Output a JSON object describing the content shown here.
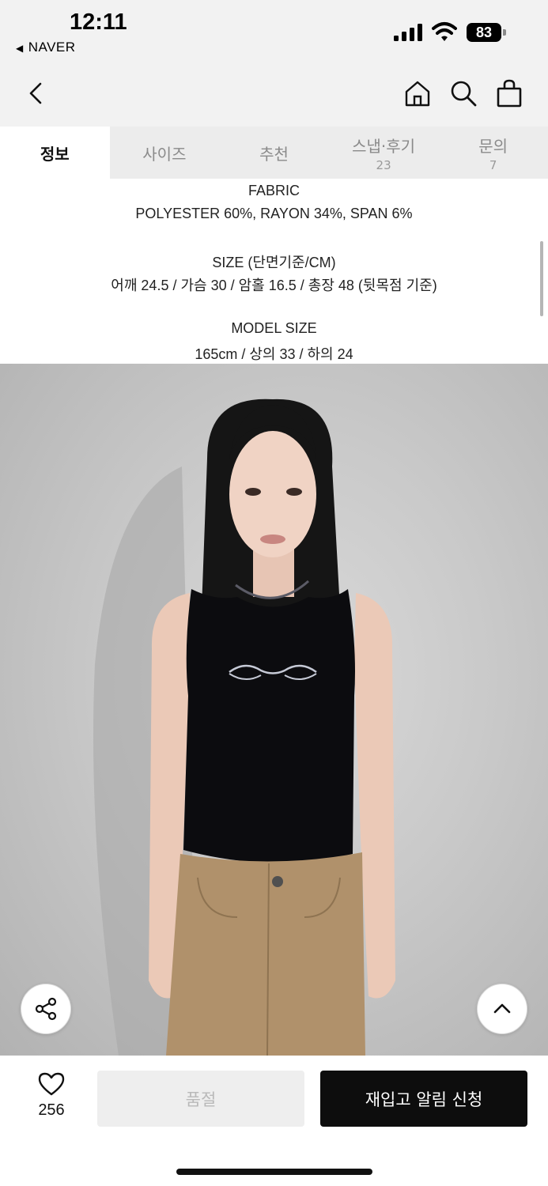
{
  "status_bar": {
    "time": "12:11",
    "back_app": "NAVER",
    "battery": "83"
  },
  "nav": {
    "icons": [
      "chevron-left-icon",
      "home-icon",
      "search-icon",
      "shopping-bag-icon"
    ]
  },
  "tabs": [
    {
      "label": "정보",
      "active": true
    },
    {
      "label": "사이즈"
    },
    {
      "label": "추천"
    },
    {
      "label": "스냅·후기",
      "count": "23"
    },
    {
      "label": "문의",
      "count": "7"
    }
  ],
  "details": {
    "fabric_title": "FABRIC",
    "fabric_value": "POLYESTER 60%, RAYON 34%, SPAN 6%",
    "size_title": "SIZE (단면기준/CM)",
    "size_value": "어깨 24.5 / 가슴 30 / 암홀 16.5 / 총장 48 (뒷목점 기준)",
    "model_title": "MODEL SIZE",
    "model_value": "165cm / 상의 33 / 하의 24"
  },
  "photo": {
    "icons": [
      "share-icon",
      "chevron-up-icon"
    ]
  },
  "bottom_bar": {
    "like_count": "256",
    "soldout_label": "품절",
    "restock_label": "재입고 알림 신청"
  },
  "colors": {
    "accent": "#0d0d0d",
    "disabled": "#eeeeee",
    "header_bg": "#f2f2f2"
  }
}
